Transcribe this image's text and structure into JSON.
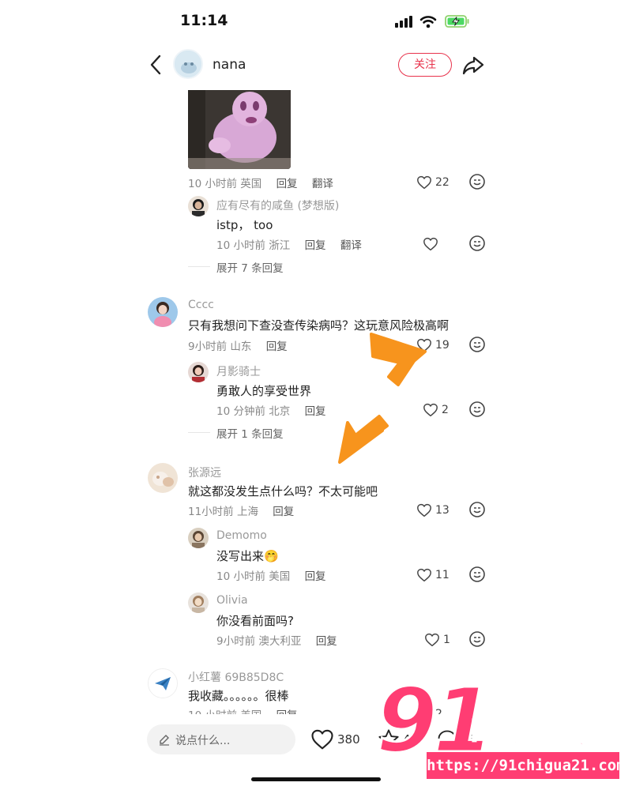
{
  "status_bar": {
    "time": "11:14"
  },
  "header": {
    "username": "nana",
    "follow_label": "关注"
  },
  "comments": [
    {
      "meta_time": "10 小时前 英国",
      "reply": "回复",
      "translate": "翻译",
      "likes": "22",
      "replies": [
        {
          "user": "应有尽有的咸鱼 (梦想版)",
          "text": "istp， too",
          "meta_time": "10 小时前 浙江",
          "reply": "回复",
          "translate": "翻译",
          "likes": ""
        }
      ],
      "expand": "展开 7 条回复"
    },
    {
      "user": "Cccc",
      "text": "只有我想问下查没查传染病吗？这玩意风险极高啊",
      "meta_time": "9小时前 山东",
      "reply": "回复",
      "likes": "19",
      "replies": [
        {
          "user": "月影骑士",
          "text": "勇敢人的享受世界",
          "meta_time": "10 分钟前 北京",
          "reply": "回复",
          "likes": "2"
        }
      ],
      "expand": "展开 1 条回复"
    },
    {
      "user": "张源远",
      "text": "就这都没发生点什么吗？不太可能吧",
      "meta_time": "11小时前 上海",
      "reply": "回复",
      "likes": "13",
      "replies": [
        {
          "user": "Demomo",
          "text": "没写出来🤭",
          "meta_time": "10 小时前 美国",
          "reply": "回复",
          "likes": "11"
        },
        {
          "user": "Olivia",
          "text": "你没看前面吗?",
          "meta_time": "9小时前 澳大利亚",
          "reply": "回复",
          "likes": "1"
        }
      ]
    },
    {
      "user": "小红薯 69B85D8C",
      "text": "我收藏。。。。。。很棒",
      "meta_time": "10 小时前 美国",
      "reply": "回复",
      "likes": "2"
    }
  ],
  "bottom_bar": {
    "input_placeholder": "说点什么...",
    "likes": "380",
    "stars": "43",
    "comments": "135"
  },
  "watermark": {
    "number": "91",
    "text": "吃瓜中心",
    "url": "https://91chigua21.com"
  },
  "colors": {
    "accent": "#e8334c",
    "arrow": "#f7941d",
    "watermark": "#ff3d73"
  }
}
